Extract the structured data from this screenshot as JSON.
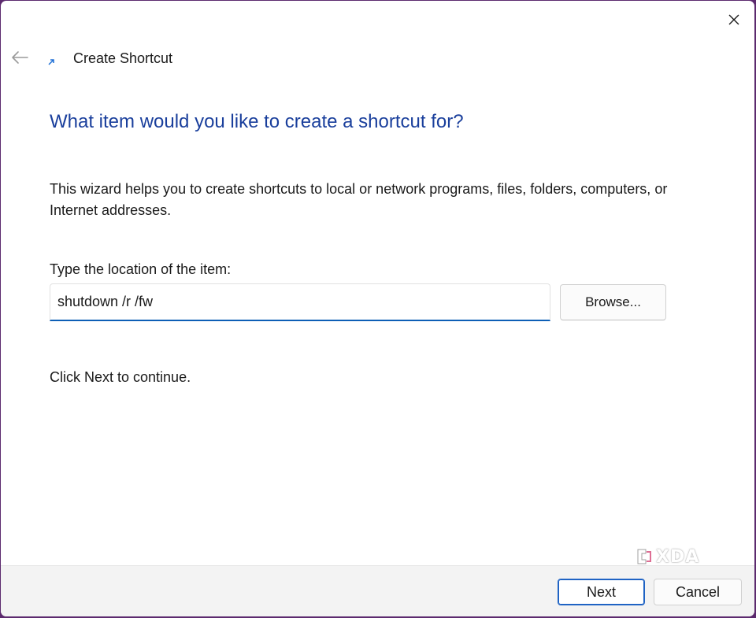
{
  "window": {
    "title": "Create Shortcut"
  },
  "main": {
    "heading": "What item would you like to create a shortcut for?",
    "description": "This wizard helps you to create shortcuts to local or network programs, files, folders, computers, or Internet addresses.",
    "location_label": "Type the location of the item:",
    "location_value": "shutdown /r /fw",
    "browse_label": "Browse...",
    "continue_text": "Click Next to continue."
  },
  "footer": {
    "next_label": "Next",
    "cancel_label": "Cancel"
  },
  "watermark": {
    "text": "XDA"
  },
  "icons": {
    "close": "close-icon",
    "back": "back-arrow-icon",
    "shortcut": "shortcut-arrow-icon",
    "watermark": "xda-logo-icon"
  },
  "colors": {
    "heading": "#1a3f9c",
    "accent": "#0d5fb6",
    "footer_bg": "#f3f3f3",
    "window_border": "#5c2a6e"
  }
}
